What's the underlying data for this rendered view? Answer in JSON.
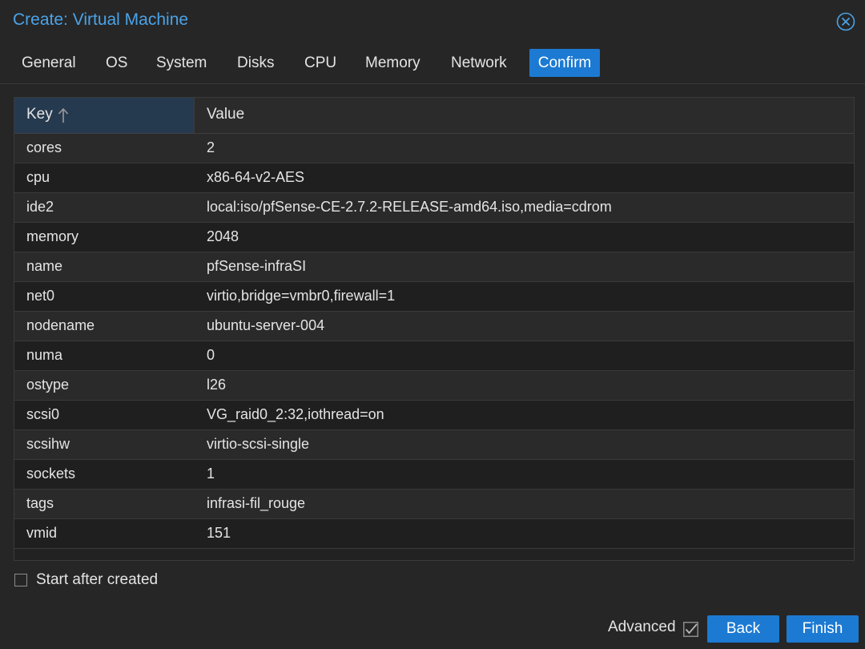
{
  "window": {
    "title": "Create: Virtual Machine"
  },
  "tabs": [
    {
      "label": "General"
    },
    {
      "label": "OS"
    },
    {
      "label": "System"
    },
    {
      "label": "Disks"
    },
    {
      "label": "CPU"
    },
    {
      "label": "Memory"
    },
    {
      "label": "Network"
    },
    {
      "label": "Confirm",
      "active": true
    }
  ],
  "grid": {
    "headers": {
      "key": "Key",
      "value": "Value"
    },
    "sort": {
      "column": "key",
      "direction": "ascending"
    },
    "rows": [
      {
        "key": "cores",
        "value": "2"
      },
      {
        "key": "cpu",
        "value": "x86-64-v2-AES"
      },
      {
        "key": "ide2",
        "value": "local:iso/pfSense-CE-2.7.2-RELEASE-amd64.iso,media=cdrom"
      },
      {
        "key": "memory",
        "value": "2048"
      },
      {
        "key": "name",
        "value": "pfSense-infraSI"
      },
      {
        "key": "net0",
        "value": "virtio,bridge=vmbr0,firewall=1"
      },
      {
        "key": "nodename",
        "value": "ubuntu-server-004"
      },
      {
        "key": "numa",
        "value": "0"
      },
      {
        "key": "ostype",
        "value": "l26"
      },
      {
        "key": "scsi0",
        "value": "VG_raid0_2:32,iothread=on"
      },
      {
        "key": "scsihw",
        "value": "virtio-scsi-single"
      },
      {
        "key": "sockets",
        "value": "1"
      },
      {
        "key": "tags",
        "value": "infrasi-fil_rouge"
      },
      {
        "key": "vmid",
        "value": "151"
      }
    ]
  },
  "options": {
    "start_after_created_label": "Start after created",
    "start_after_created": false
  },
  "footer": {
    "advanced_label": "Advanced",
    "advanced_checked": true,
    "back_label": "Back",
    "finish_label": "Finish"
  },
  "colors": {
    "accent": "#1c7ad2",
    "title": "#4aa3e8",
    "background": "#262626",
    "header_sorted": "#263a4f"
  },
  "icons": {
    "close": "close-circle-icon",
    "sort": "sort-ascending-icon",
    "checkbox_checked": "checkmark-icon"
  }
}
